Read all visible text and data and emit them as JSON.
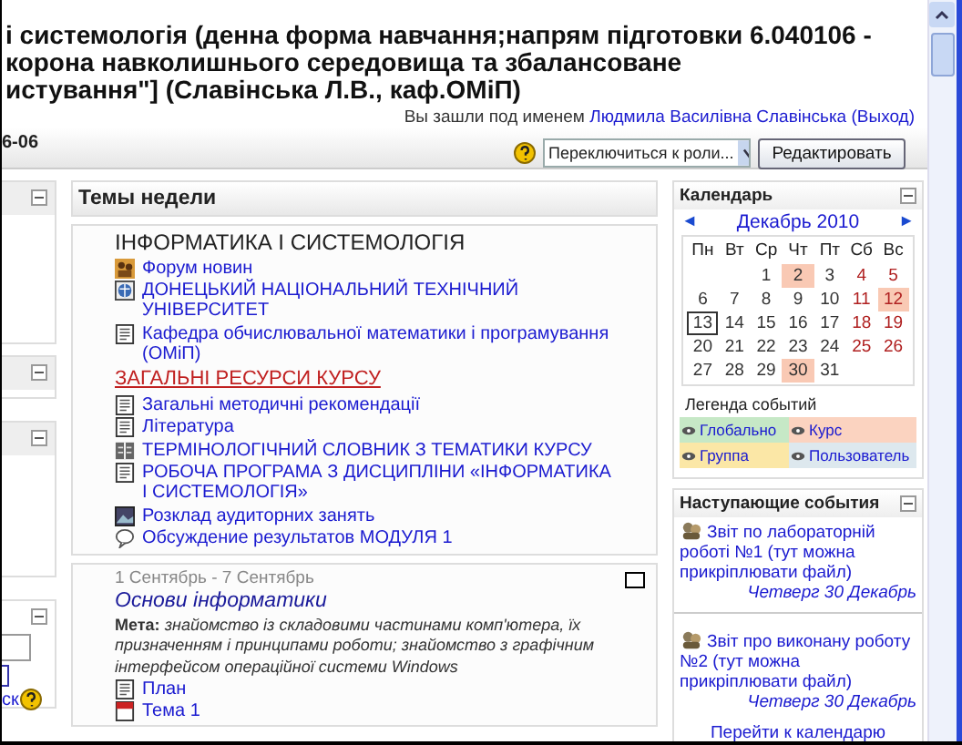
{
  "header": {
    "title_lines": [
      "і системологія (денна форма навчання;напрям підготовки 6.040106 -",
      "корона навколишнього середовища та збалансоване",
      "истування\"] (Славінська Л.В., каф.ОМіП)"
    ],
    "login_prefix": "Вы зашли под именем",
    "user": "Людмила Василівна Славінська",
    "logout": "(Выход)"
  },
  "navbar": {
    "breadcrumb": "6-06",
    "role_select": "Переключиться к роли...",
    "edit_button": "Редактировать"
  },
  "left_column": {
    "search_link": "ск"
  },
  "weeks": {
    "title": "Темы недели",
    "sections": [
      {
        "title": "ІНФОРМАТИКА І СИСТЕМОЛОГІЯ",
        "items": [
          {
            "kind": "forum",
            "text": "Форум новин"
          },
          {
            "kind": "web",
            "text": "ДОНЕЦЬКИЙ НАЦІОНАЛЬНИЙ ТЕХНІЧНИЙ УНІВЕРСИТЕТ"
          },
          {
            "kind": "file",
            "text": "Кафедра обчислювальної математики і програмування (ОМіП)"
          },
          {
            "kind": "label",
            "text": "ЗАГАЛЬНІ РЕСУРСИ КУРСУ"
          },
          {
            "kind": "doc",
            "text": "Загальні методичні рекомендації"
          },
          {
            "kind": "file",
            "text": "Література"
          },
          {
            "kind": "glossary",
            "text": "ТЕРМІНОЛОГІЧНИЙ СЛОВНИК З ТЕМАТИКИ КУРСУ"
          },
          {
            "kind": "doc",
            "text": "РОБОЧА ПРОГРАМА З ДИСЦИПЛІНИ «ІНФОРМАТИКА І СИСТЕМОЛОГІЯ»"
          },
          {
            "kind": "image",
            "text": "Розклад аудиторних занять"
          },
          {
            "kind": "chat",
            "text": "Обсуждение результатов МОДУЛЯ 1"
          }
        ]
      },
      {
        "dates": "1 Сентябрь - 7 Сентябрь",
        "title": "Основи інформатики",
        "summary": "**Мета:** *знайомство із складовими частинами комп'ютера, їх призначенням і принципами роботи; знайомство з графічним інтерфейсом операційної системи Windows*",
        "items": [
          {
            "kind": "file",
            "text": "План"
          },
          {
            "kind": "pdf",
            "text": "Тема 1"
          }
        ]
      }
    ]
  },
  "calendar": {
    "title": "Календарь",
    "prev": "◄",
    "month": "Декабрь 2010",
    "next": "►",
    "weekdays": [
      "Пн",
      "Вт",
      "Ср",
      "Чт",
      "Пт",
      "Сб",
      "Вс"
    ],
    "weeks": [
      [
        {
          "d": "1",
          "event": false,
          "today": false
        },
        {
          "d": "2",
          "event": true,
          "today": false
        },
        {
          "d": "3",
          "event": false,
          "today": false
        },
        {
          "d": "4",
          "event": false,
          "today": false
        },
        {
          "d": "5",
          "event": false,
          "today": false
        }
      ],
      [
        {
          "d": "6",
          "event": false,
          "today": false
        },
        {
          "d": "7",
          "event": false,
          "today": false
        },
        {
          "d": "8",
          "event": false,
          "today": false
        },
        {
          "d": "9",
          "event": false,
          "today": false
        },
        {
          "d": "10",
          "event": false,
          "today": false
        },
        {
          "d": "11",
          "event": false,
          "today": false
        },
        {
          "d": "12",
          "event": true,
          "today": false
        }
      ],
      [
        {
          "d": "13",
          "event": false,
          "today": true
        },
        {
          "d": "14",
          "event": false,
          "today": false
        },
        {
          "d": "15",
          "event": false,
          "today": false
        },
        {
          "d": "16",
          "event": false,
          "today": false
        },
        {
          "d": "17",
          "event": false,
          "today": false
        },
        {
          "d": "18",
          "event": false,
          "today": false
        },
        {
          "d": "19",
          "event": false,
          "today": false
        }
      ],
      [
        {
          "d": "20",
          "event": false,
          "today": false
        },
        {
          "d": "21",
          "event": false,
          "today": false
        },
        {
          "d": "22",
          "event": false,
          "today": false
        },
        {
          "d": "23",
          "event": false,
          "today": false
        },
        {
          "d": "24",
          "event": false,
          "today": false
        },
        {
          "d": "25",
          "event": false,
          "today": false
        },
        {
          "d": "26",
          "event": false,
          "today": false
        }
      ],
      [
        {
          "d": "27",
          "event": false,
          "today": false
        },
        {
          "d": "28",
          "event": false,
          "today": false
        },
        {
          "d": "29",
          "event": false,
          "today": false
        },
        {
          "d": "30",
          "event": true,
          "today": false
        },
        {
          "d": "31",
          "event": false,
          "today": false
        }
      ]
    ],
    "legend_title": "Легенда событий",
    "legend": [
      {
        "label": "Глобально",
        "color": "#c6e8c6"
      },
      {
        "label": "Курс",
        "color": "#fbd3c0"
      },
      {
        "label": "Группа",
        "color": "#fbe7a6"
      },
      {
        "label": "Пользователь",
        "color": "#dde8ee"
      }
    ]
  },
  "upcoming": {
    "title": "Наступающие события",
    "events": [
      {
        "title": "Звіт по лабораторній роботі №1 (тут можна прикріплювати файл)",
        "date": "Четверг 30 Декабрь"
      },
      {
        "title": "Звіт про виконану роботу №2 (тут можна прикріплювати файл)",
        "date": "Четверг 30 Декабрь"
      }
    ],
    "calendar_link": "Перейти к календарю"
  }
}
